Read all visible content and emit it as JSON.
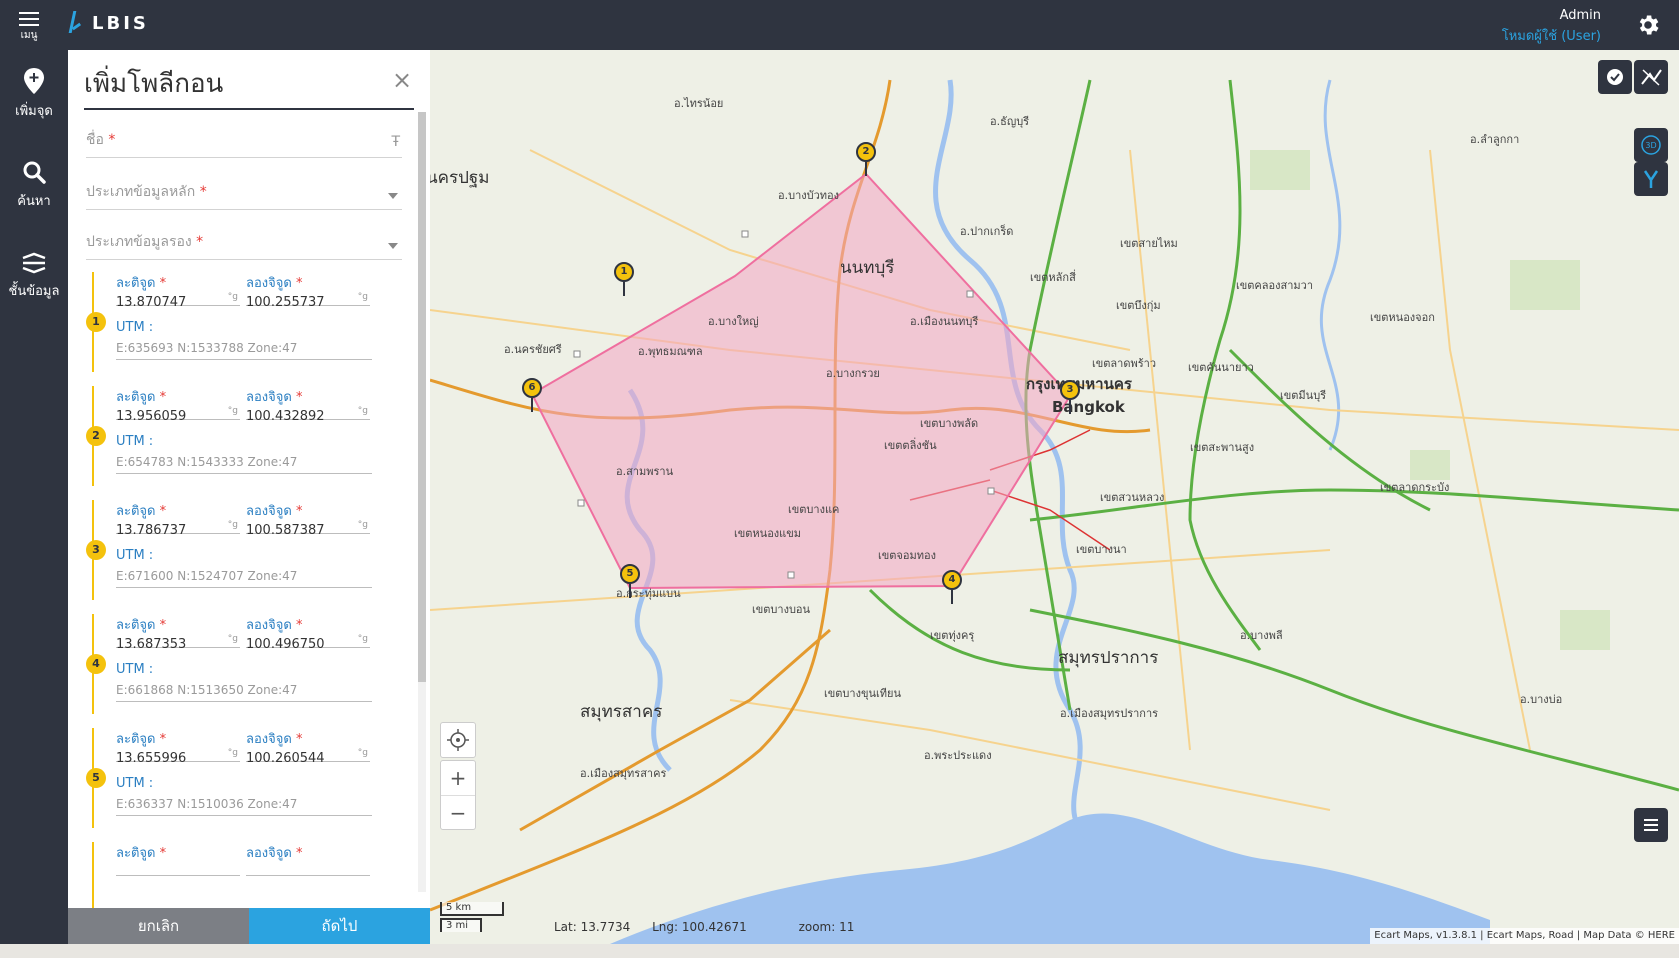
{
  "topbar": {
    "menu_label": "เมนู",
    "brand": "LBIS",
    "user_name": "Admin",
    "user_mode": "โหมดผู้ใช้ (User)"
  },
  "rail": {
    "items": [
      {
        "label": "เพิ่มจุด",
        "icon": "add-pin-icon"
      },
      {
        "label": "ค้นหา",
        "icon": "search-icon"
      },
      {
        "label": "ชั้นข้อมูล",
        "icon": "layers-icon"
      }
    ]
  },
  "panel": {
    "title": "เพิ่มโพลีกอน",
    "name_placeholder": "ชื่อ",
    "main_type_placeholder": "ประเภทข้อมูลหลัก",
    "sub_type_placeholder": "ประเภทข้อมูลรอง",
    "required_mark": "*",
    "lat_label": "ละติจูด",
    "lng_label": "ลองจิจูด",
    "utm_label": "UTM :",
    "unit_label": "°g",
    "points": [
      {
        "n": "1",
        "lat": "13.870747",
        "lng": "100.255737",
        "utm": "E:635693 N:1533788 Zone:47"
      },
      {
        "n": "2",
        "lat": "13.956059",
        "lng": "100.432892",
        "utm": "E:654783 N:1543333 Zone:47"
      },
      {
        "n": "3",
        "lat": "13.786737",
        "lng": "100.587387",
        "utm": "E:671600 N:1524707 Zone:47"
      },
      {
        "n": "4",
        "lat": "13.687353",
        "lng": "100.496750",
        "utm": "E:661868 N:1513650 Zone:47"
      },
      {
        "n": "5",
        "lat": "13.655996",
        "lng": "100.260544",
        "utm": "E:636337 N:1510036 Zone:47"
      },
      {
        "n": "6",
        "lat": "",
        "lng": "",
        "utm": ""
      }
    ],
    "cancel_label": "ยกเลิก",
    "next_label": "ถัดไป"
  },
  "map": {
    "labels": {
      "nonthaburi": "นนทบุรี",
      "bangkok_th": "กรุงเทพมหานคร",
      "bangkok_en": "Bangkok",
      "samut_prakan": "สมุทรปราการ",
      "samut_sakhon": "สมุทรสาคร",
      "nakhon_pathom": "นครปฐม",
      "pathum": "อ.ธัญบุรี",
      "sai_noi": "อ.ไทรน้อย",
      "bang_bua_thong": "อ.บางบัวทอง",
      "bang_yai": "อ.บางใหญ่",
      "pak_kret": "อ.ปากเกร็ด",
      "mueang_nonthaburi": "อ.เมืองนนทบุรี",
      "phutthamonthon": "อ.พุทธมณฑล",
      "bang_kruai": "อ.บางกรวย",
      "sam_phran": "อ.สามพราน",
      "krathum_baen": "อ.กระทุ่มแบน",
      "nakhon_chai_si": "อ.นครชัยศรี",
      "bang_khae": "เขตบางแค",
      "nong_khaem": "เขตหนองแขม",
      "bang_bon": "เขตบางบอน",
      "bang_khun_thian": "เขตบางขุนเทียน",
      "chom_thong": "เขตจอมทอง",
      "thung_khru": "เขตทุ่งครุ",
      "bang_phlat": "เขตบางพลัด",
      "taling_chan": "เขตตลิ่งชัน",
      "lat_phrao": "เขตลาดพร้าว",
      "bueng_kum": "เขตบึงกุ่ม",
      "khan_na_yao": "เขตคันนายาว",
      "min_buri": "เขตมีนบุรี",
      "saphan_sung": "เขตสะพานสูง",
      "suan_luang": "เขตสวนหลวง",
      "lat_krabang": "เขตลาดกระบัง",
      "bang_na": "เขตบางนา",
      "sai_mai": "เขตสายไหม",
      "lak_si": "เขตหลักสี่",
      "khlong_sam_wa": "เขตคลองสามวา",
      "nong_chok": "เขตหนองจอก",
      "bang_phli": "อ.บางพลี",
      "mueang_samut_prakan": "อ.เมืองสมุทรปราการ",
      "phra_pradaeng": "อ.พระประแดง",
      "mueang_samut_sakhon": "อ.เมืองสมุทรสาคร",
      "bang_bo": "อ.บางบ่อ",
      "lam_luk_ka": "อ.ลำลูกกา"
    },
    "pins": [
      "1",
      "2",
      "3",
      "4",
      "5",
      "6"
    ],
    "status": {
      "lat": "Lat: 13.7734",
      "lng": "Lng: 100.42671",
      "zoom": "zoom: 11"
    },
    "scale_km": "5 km",
    "scale_mi": "3 mi",
    "attribution": "Ecart Maps, v1.3.8.1 | Ecart Maps, Road | Map Data © HERE",
    "zoom_in": "+",
    "zoom_out": "−",
    "colors": {
      "polygon_fill": "#f4a6c2",
      "polygon_stroke": "#ef6f9f",
      "accent": "#2ba3e0",
      "pin": "#f4c20d"
    }
  }
}
